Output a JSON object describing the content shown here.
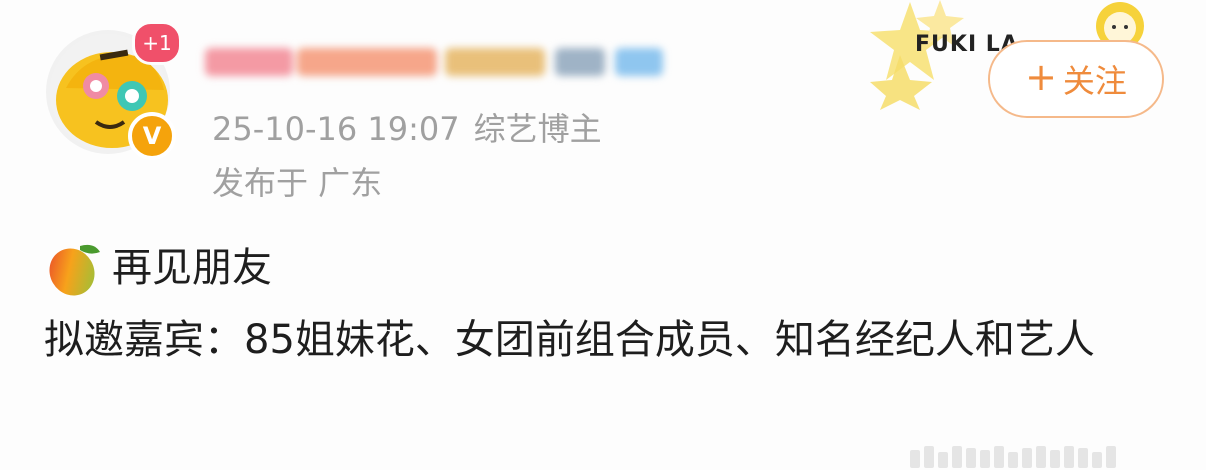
{
  "user": {
    "notification_badge": "+1",
    "verified_mark": "V",
    "post_time": "25-10-16 19:07",
    "role": "综艺博主",
    "location": "发布于 广东"
  },
  "decoration": {
    "text": "FUKI LA"
  },
  "follow_button": {
    "plus": "+",
    "label": "关注"
  },
  "post": {
    "title": "再见朋友",
    "body": "拟邀嘉宾：85姐妹花、女团前组合成员、知名经纪人和艺人"
  },
  "icons": [
    "mango-emoji-icon",
    "avatar-mascot-icon",
    "verified-icon"
  ],
  "colors": {
    "accent": "#ef8b3c",
    "badge": "#f0506a",
    "verified": "#f5a30c",
    "meta": "#a0a0a0"
  }
}
